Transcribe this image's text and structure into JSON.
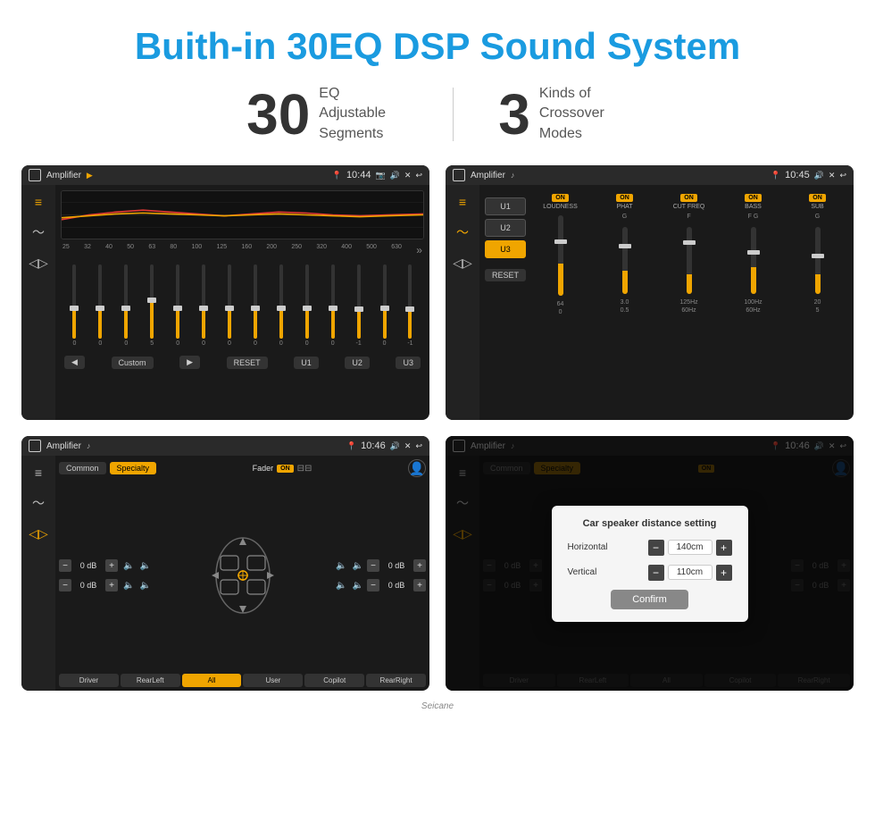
{
  "page": {
    "title": "Buith-in 30EQ DSP Sound System",
    "stat1_number": "30",
    "stat1_label": "EQ Adjustable\nSegments",
    "stat2_number": "3",
    "stat2_label": "Kinds of\nCrossover Modes"
  },
  "screens": {
    "screen1": {
      "title": "Amplifier",
      "time": "10:44",
      "freq_labels": [
        "25",
        "32",
        "40",
        "50",
        "63",
        "80",
        "100",
        "125",
        "160",
        "200",
        "250",
        "320",
        "400",
        "500",
        "630"
      ],
      "eq_values": [
        "0",
        "0",
        "0",
        "5",
        "0",
        "0",
        "0",
        "0",
        "0",
        "0",
        "0",
        "-1",
        "0",
        "-1"
      ],
      "bottom_buttons": [
        "Custom",
        "RESET",
        "U1",
        "U2",
        "U3"
      ]
    },
    "screen2": {
      "title": "Amplifier",
      "time": "10:45",
      "presets": [
        "U1",
        "U2",
        "U3"
      ],
      "active_preset": "U3",
      "channels": [
        {
          "label": "LOUDNESS",
          "on": true
        },
        {
          "label": "PHAT",
          "on": true
        },
        {
          "label": "CUT FREQ",
          "on": true
        },
        {
          "label": "BASS",
          "on": true
        },
        {
          "label": "SUB",
          "on": true
        }
      ],
      "reset_btn": "RESET"
    },
    "screen3": {
      "title": "Amplifier",
      "time": "10:46",
      "presets": [
        "Common",
        "Specialty"
      ],
      "active_preset": "Specialty",
      "fader_label": "Fader",
      "fader_on": "ON",
      "volumes": [
        {
          "label": "0 dB"
        },
        {
          "label": "0 dB"
        },
        {
          "label": "0 dB"
        },
        {
          "label": "0 dB"
        }
      ],
      "position_btns": [
        "Driver",
        "RearLeft",
        "All",
        "Copilot",
        "RearRight"
      ],
      "active_position": "All",
      "user_btn": "User"
    },
    "screen4": {
      "title": "Amplifier",
      "time": "10:46",
      "presets": [
        "Common",
        "Specialty"
      ],
      "active_preset": "Specialty",
      "dialog": {
        "title": "Car speaker distance setting",
        "horizontal_label": "Horizontal",
        "horizontal_value": "140cm",
        "vertical_label": "Vertical",
        "vertical_value": "110cm",
        "confirm_btn": "Confirm"
      },
      "volumes": [
        {
          "label": "0 dB"
        },
        {
          "label": "0 dB"
        }
      ],
      "position_btns": [
        "Driver",
        "RearLeft",
        "All",
        "Copilot",
        "RearRight"
      ],
      "user_btn": "User"
    }
  },
  "watermark": "Seicane"
}
